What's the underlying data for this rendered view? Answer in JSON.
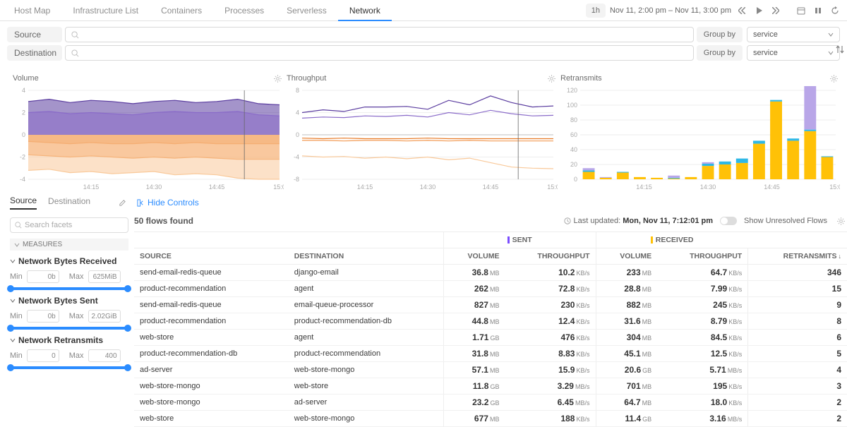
{
  "nav": {
    "items": [
      "Host Map",
      "Infrastructure List",
      "Containers",
      "Processes",
      "Serverless",
      "Network"
    ],
    "active_index": 5,
    "time_btn": "1h",
    "time_label": "Nov 11, 2:00 pm – Nov 11, 3:00 pm"
  },
  "filters": {
    "source_label": "Source",
    "destination_label": "Destination",
    "groupby_label": "Group by",
    "groupby_value": "service"
  },
  "chart_titles": {
    "volume": "Volume",
    "throughput": "Throughput",
    "retransmits": "Retransmits"
  },
  "chart_data": [
    {
      "type": "area",
      "title": "Volume",
      "xlabel": "",
      "ylabel": "",
      "x": [
        "14:00",
        "14:05",
        "14:10",
        "14:15",
        "14:20",
        "14:25",
        "14:30",
        "14:35",
        "14:40",
        "14:45",
        "14:50",
        "14:55",
        "15:00"
      ],
      "ylim": [
        -4,
        4
      ],
      "xticks": [
        "14:15",
        "14:30",
        "14:45",
        "15:0"
      ],
      "series": [
        {
          "name": "sent-upper",
          "color": "#5a3c9f",
          "values": [
            3.0,
            3.2,
            2.9,
            3.1,
            3.0,
            2.8,
            3.0,
            3.1,
            2.9,
            3.0,
            3.2,
            2.8,
            2.7
          ]
        },
        {
          "name": "sent-lower",
          "color": "#8a6bc9",
          "values": [
            2.0,
            2.1,
            1.9,
            2.0,
            1.9,
            1.8,
            2.0,
            2.1,
            2.0,
            2.0,
            2.1,
            1.8,
            1.7
          ]
        },
        {
          "name": "recv-upper",
          "color": "#e87a26",
          "values": [
            -0.6,
            -0.7,
            -0.8,
            -0.7,
            -0.8,
            -0.8,
            -0.7,
            -0.8,
            -0.7,
            -0.8,
            -0.8,
            -0.8,
            -0.8
          ]
        },
        {
          "name": "recv-mid",
          "color": "#f29b55",
          "values": [
            -1.8,
            -1.9,
            -2.0,
            -1.9,
            -2.0,
            -2.1,
            -2.0,
            -2.1,
            -2.0,
            -2.1,
            -2.2,
            -2.2,
            -2.2
          ]
        },
        {
          "name": "recv-lower",
          "color": "#f9c99a",
          "values": [
            -3.2,
            -3.1,
            -3.4,
            -3.3,
            -3.5,
            -3.4,
            -3.3,
            -3.6,
            -3.5,
            -3.6,
            -3.9,
            -4.0,
            -4.0
          ]
        }
      ]
    },
    {
      "type": "line",
      "title": "Throughput",
      "xlabel": "",
      "ylabel": "",
      "x": [
        "14:00",
        "14:05",
        "14:10",
        "14:15",
        "14:20",
        "14:25",
        "14:30",
        "14:35",
        "14:40",
        "14:45",
        "14:50",
        "14:55",
        "15:00"
      ],
      "ylim": [
        -8,
        8
      ],
      "xticks": [
        "14:15",
        "14:30",
        "14:45",
        "15:0"
      ],
      "series": [
        {
          "name": "sent-a",
          "color": "#5a3c9f",
          "values": [
            4.0,
            4.5,
            4.2,
            5.0,
            5.0,
            5.1,
            4.6,
            6.2,
            5.4,
            7.0,
            5.8,
            5.0,
            5.2
          ]
        },
        {
          "name": "sent-b",
          "color": "#8a6bc9",
          "values": [
            3.0,
            3.2,
            3.1,
            3.4,
            3.3,
            3.5,
            3.2,
            4.0,
            3.6,
            4.4,
            3.8,
            3.4,
            3.5
          ]
        },
        {
          "name": "zero",
          "color": "#ccc",
          "values": [
            0.0,
            0.0,
            0.0,
            0.0,
            0.0,
            0.0,
            0.0,
            0.0,
            0.0,
            0.0,
            0.0,
            0.0,
            0.0
          ]
        },
        {
          "name": "recv-a",
          "color": "#e87a26",
          "values": [
            -0.6,
            -0.7,
            -0.6,
            -0.7,
            -0.7,
            -0.7,
            -0.6,
            -0.7,
            -0.7,
            -0.7,
            -0.7,
            -0.7,
            -0.7
          ]
        },
        {
          "name": "recv-b",
          "color": "#f29b55",
          "values": [
            -1.0,
            -1.0,
            -1.1,
            -1.0,
            -1.0,
            -1.1,
            -1.0,
            -1.1,
            -1.0,
            -1.1,
            -1.1,
            -1.1,
            -1.1
          ]
        },
        {
          "name": "recv-c",
          "color": "#f9c99a",
          "values": [
            -3.8,
            -4.0,
            -3.9,
            -4.2,
            -4.0,
            -4.3,
            -4.0,
            -4.5,
            -4.2,
            -5.0,
            -5.8,
            -6.0,
            -6.1
          ]
        }
      ]
    },
    {
      "type": "bar",
      "title": "Retransmits",
      "xlabel": "",
      "ylabel": "",
      "categories": [
        "14:02",
        "14:06",
        "14:10",
        "14:14",
        "14:18",
        "14:22",
        "14:26",
        "14:30",
        "14:34",
        "14:38",
        "14:42",
        "14:46",
        "14:50",
        "14:54",
        "14:58"
      ],
      "ylim": [
        0,
        120
      ],
      "xticks": [
        "14:15",
        "14:30",
        "14:45",
        "15:0"
      ],
      "yticks": [
        0,
        20,
        40,
        60,
        80,
        100,
        120
      ],
      "series": [
        {
          "name": "main",
          "color": "#ffc107",
          "values": [
            10,
            2,
            9,
            3,
            2,
            1,
            3,
            18,
            20,
            22,
            48,
            105,
            52,
            65,
            30
          ]
        },
        {
          "name": "second",
          "color": "#2fb8e6",
          "values": [
            2,
            0,
            1,
            0,
            0,
            1,
            0,
            3,
            4,
            6,
            4,
            2,
            3,
            2,
            1
          ]
        },
        {
          "name": "third",
          "color": "#b9a6e8",
          "values": [
            3,
            1,
            0,
            0,
            0,
            3,
            0,
            2,
            0,
            0,
            0,
            0,
            0,
            60,
            0
          ]
        }
      ]
    }
  ],
  "side_tabs": {
    "source": "Source",
    "destination": "Destination"
  },
  "facet_search_placeholder": "Search facets",
  "measures_header": "MEASURES",
  "measures": [
    {
      "title": "Network Bytes Received",
      "min": "0b",
      "max": "625MiB"
    },
    {
      "title": "Network Bytes Sent",
      "min": "0b",
      "max": "2.02GiB"
    },
    {
      "title": "Network Retransmits",
      "min": "0",
      "max": "400"
    }
  ],
  "min_label": "Min",
  "max_label": "Max",
  "hide_controls": "Hide Controls",
  "flow_count": "50 flows found",
  "last_updated_prefix": "Last updated: ",
  "last_updated_time": "Mon, Nov 11, 7:12:01 pm",
  "unresolved": "Show Unresolved Flows",
  "table": {
    "group_sent": "SENT",
    "group_recv": "RECEIVED",
    "headers": [
      "SOURCE",
      "DESTINATION",
      "VOLUME",
      "THROUGHPUT",
      "VOLUME",
      "THROUGHPUT",
      "RETRANSMITS"
    ],
    "rows": [
      {
        "src": "send-email-redis-queue",
        "dst": "django-email",
        "sv": "36.8",
        "su": "MB",
        "st": "10.2",
        "stu": "KB/s",
        "rv": "233",
        "ru": "MB",
        "rt": "64.7",
        "rtu": "KB/s",
        "re": 346
      },
      {
        "src": "product-recommendation",
        "dst": "agent",
        "sv": "262",
        "su": "MB",
        "st": "72.8",
        "stu": "KB/s",
        "rv": "28.8",
        "ru": "MB",
        "rt": "7.99",
        "rtu": "KB/s",
        "re": 15
      },
      {
        "src": "send-email-redis-queue",
        "dst": "email-queue-processor",
        "sv": "827",
        "su": "MB",
        "st": "230",
        "stu": "KB/s",
        "rv": "882",
        "ru": "MB",
        "rt": "245",
        "rtu": "KB/s",
        "re": 9
      },
      {
        "src": "product-recommendation",
        "dst": "product-recommendation-db",
        "sv": "44.8",
        "su": "MB",
        "st": "12.4",
        "stu": "KB/s",
        "rv": "31.6",
        "ru": "MB",
        "rt": "8.79",
        "rtu": "KB/s",
        "re": 8
      },
      {
        "src": "web-store",
        "dst": "agent",
        "sv": "1.71",
        "su": "GB",
        "st": "476",
        "stu": "KB/s",
        "rv": "304",
        "ru": "MB",
        "rt": "84.5",
        "rtu": "KB/s",
        "re": 6
      },
      {
        "src": "product-recommendation-db",
        "dst": "product-recommendation",
        "sv": "31.8",
        "su": "MB",
        "st": "8.83",
        "stu": "KB/s",
        "rv": "45.1",
        "ru": "MB",
        "rt": "12.5",
        "rtu": "KB/s",
        "re": 5
      },
      {
        "src": "ad-server",
        "dst": "web-store-mongo",
        "sv": "57.1",
        "su": "MB",
        "st": "15.9",
        "stu": "KB/s",
        "rv": "20.6",
        "ru": "GB",
        "rt": "5.71",
        "rtu": "MB/s",
        "re": 4
      },
      {
        "src": "web-store-mongo",
        "dst": "web-store",
        "sv": "11.8",
        "su": "GB",
        "st": "3.29",
        "stu": "MB/s",
        "rv": "701",
        "ru": "MB",
        "rt": "195",
        "rtu": "KB/s",
        "re": 3
      },
      {
        "src": "web-store-mongo",
        "dst": "ad-server",
        "sv": "23.2",
        "su": "GB",
        "st": "6.45",
        "stu": "MB/s",
        "rv": "64.7",
        "ru": "MB",
        "rt": "18.0",
        "rtu": "KB/s",
        "re": 2
      },
      {
        "src": "web-store",
        "dst": "web-store-mongo",
        "sv": "677",
        "su": "MB",
        "st": "188",
        "stu": "KB/s",
        "rv": "11.4",
        "ru": "GB",
        "rt": "3.16",
        "rtu": "MB/s",
        "re": 2
      }
    ]
  }
}
